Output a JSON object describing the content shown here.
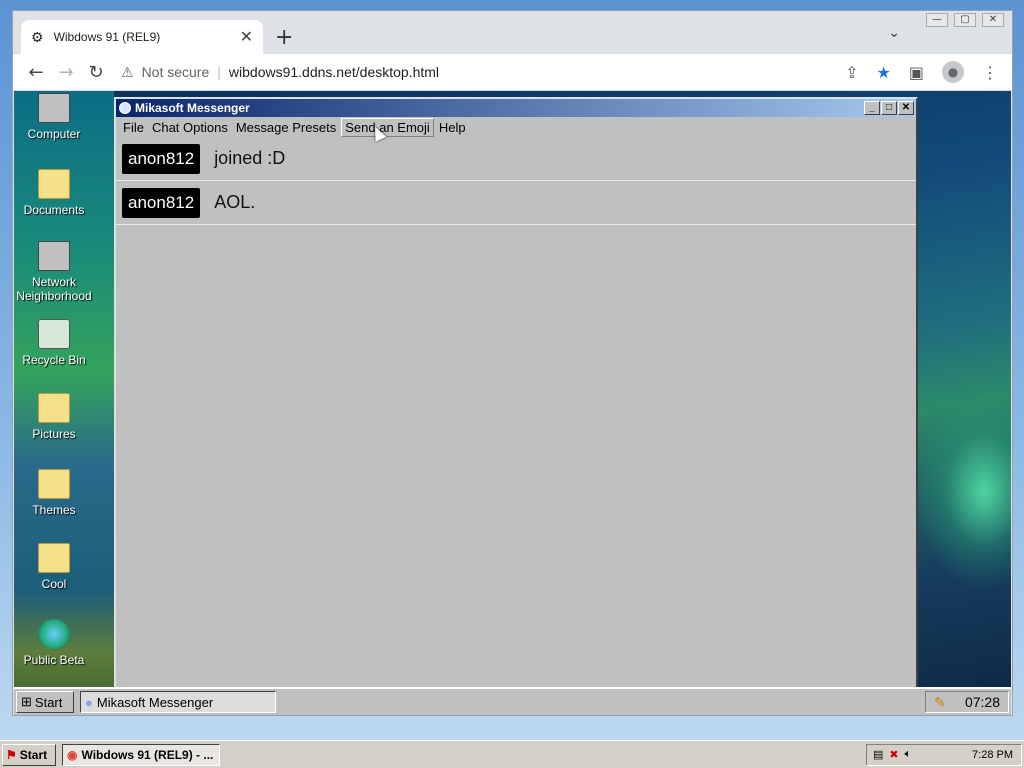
{
  "browser": {
    "tab_title": "Wibdows 91 (REL9)",
    "tab_close": "✕",
    "new_tab": "+",
    "tab_dropdown": "⌄",
    "security": "Not secure",
    "url": "wibdows91.ddns.net/desktop.html",
    "win_minimize": "—",
    "win_maximize": "▢",
    "win_close": "✕"
  },
  "desktop": {
    "icons": [
      {
        "label": "Computer"
      },
      {
        "label": "Documents"
      },
      {
        "label": "Network Neighborhood"
      },
      {
        "label": "Recycle Bin"
      },
      {
        "label": "Pictures"
      },
      {
        "label": "Themes"
      },
      {
        "label": "Cool"
      },
      {
        "label": "Public Beta"
      }
    ]
  },
  "messenger": {
    "title": "Mikasoft Messenger",
    "menu": [
      "File",
      "Chat Options",
      "Message Presets",
      "Send an Emoji",
      "Help"
    ],
    "messages": [
      {
        "user": "anon812",
        "text": "joined :D"
      },
      {
        "user": "anon812",
        "text": "AOL."
      }
    ]
  },
  "w91_taskbar": {
    "start_label": "Start",
    "task_label": "Mikasoft Messenger",
    "clock": "07:28"
  },
  "host_taskbar": {
    "start_label": "Start",
    "task_label": "Wibdows 91 (REL9) - ...",
    "clock": "7:28 PM"
  }
}
